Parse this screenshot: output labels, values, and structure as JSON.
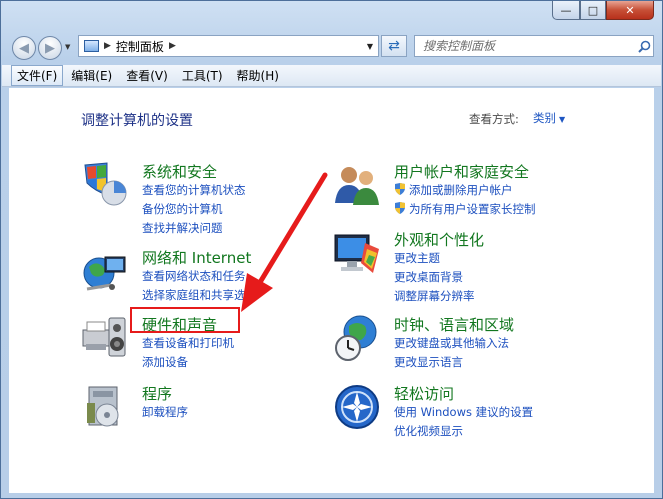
{
  "address": {
    "path": "控制面板"
  },
  "search": {
    "placeholder": "搜索控制面板"
  },
  "menu": [
    "文件(F)",
    "编辑(E)",
    "查看(V)",
    "工具(T)",
    "帮助(H)"
  ],
  "main": {
    "title": "调整计算机的设置",
    "view_by_label": "查看方式:",
    "view_by_value": "类别"
  },
  "categories": [
    {
      "title": "系统和安全",
      "links": [
        "查看您的计算机状态",
        "备份您的计算机",
        "查找并解决问题"
      ]
    },
    {
      "title": "网络和 Internet",
      "links": [
        "查看网络状态和任务",
        "选择家庭组和共享选项"
      ]
    },
    {
      "title": "硬件和声音",
      "links": [
        "查看设备和打印机",
        "添加设备"
      ]
    },
    {
      "title": "程序",
      "links": [
        "卸载程序"
      ]
    },
    {
      "title": "用户帐户和家庭安全",
      "links": [
        "添加或删除用户帐户",
        "为所有用户设置家长控制"
      ]
    },
    {
      "title": "外观和个性化",
      "links": [
        "更改主题",
        "更改桌面背景",
        "调整屏幕分辨率"
      ]
    },
    {
      "title": "时钟、语言和区域",
      "links": [
        "更改键盘或其他输入法",
        "更改显示语言"
      ]
    },
    {
      "title": "轻松访问",
      "links": [
        "使用 Windows 建议的设置",
        "优化视频显示"
      ]
    }
  ],
  "colors": {
    "accent_green": "#12771f",
    "link_blue": "#1d50bf",
    "title_blue": "#1e3287",
    "highlight_red": "#e61b1b"
  }
}
